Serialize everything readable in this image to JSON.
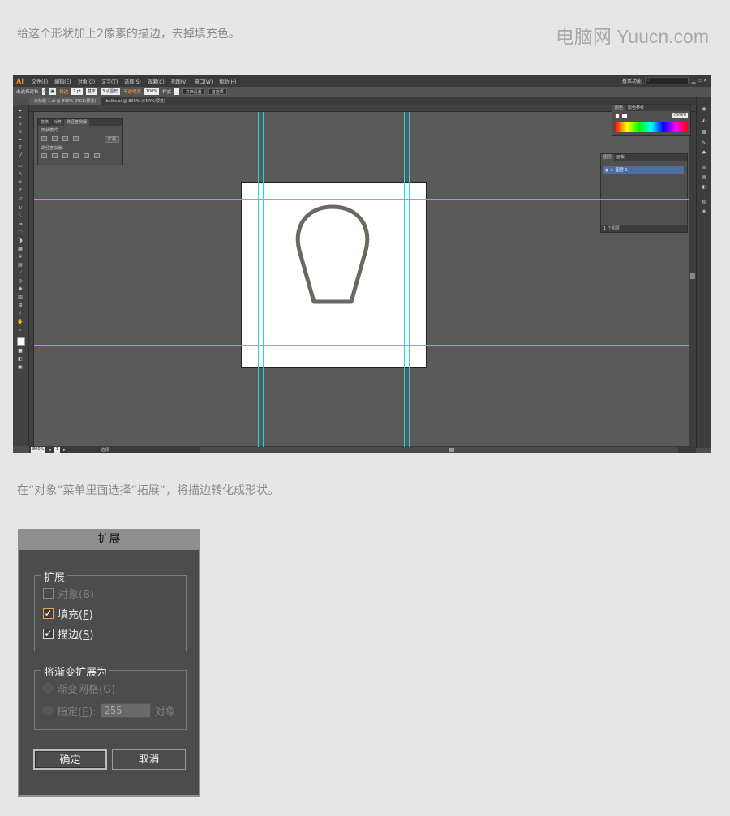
{
  "caption_top": "给这个形状加上2像素的描边，去掉填充色。",
  "watermark": "电脑网 Yuucn.com",
  "caption_mid": "在“对象“菜单里面选择”拓展“，将描边转化成形状。",
  "illustrator": {
    "logo": "Ai",
    "menus": [
      "文件(F)",
      "编辑(E)",
      "对象(O)",
      "文字(T)",
      "选择(S)",
      "效果(C)",
      "视图(V)",
      "窗口(W)",
      "帮助(H)"
    ],
    "workspace": "基本功能",
    "control_bar": {
      "selection": "未选择对象",
      "stroke_label": "描边",
      "stroke_weight": "2 pt",
      "stroke_style": "基本",
      "brush": "3 点圆形",
      "opacity_label": "不透明度",
      "opacity": "100%",
      "style_label": "样式",
      "doc_setup": "文档设置",
      "preferences": "首选项"
    },
    "tabs": [
      "未标题-1.ai @ 800% (RGB/预览)",
      "bulbs.ai @ 800% (CMYK/预览)"
    ],
    "pathfinder_panel": {
      "tabs": [
        "变换",
        "对齐",
        "路径查找器"
      ],
      "shape_modes": "形状模式：",
      "expand": "扩展",
      "pathfinders": "路径查找器："
    },
    "color_panel": {
      "tabs": [
        "颜色",
        "颜色参考"
      ],
      "hex": "f0f0f0"
    },
    "layers_panel": {
      "tabs": [
        "图层",
        "画板"
      ],
      "layer": "图层 1",
      "footer": "1 个图层"
    },
    "status": {
      "zoom": "800%",
      "page": "1",
      "mode": "选择"
    },
    "guides": {
      "stroke_color": "#1fd6e0"
    },
    "shape": {
      "stroke_color": "#6d6762",
      "stroke_width": 5
    }
  },
  "expand_dialog": {
    "title": "扩展",
    "group1_label": "扩展",
    "object": "对象(",
    "object_key": "B",
    "fill": "填充(",
    "fill_key": "F",
    "stroke": "描边(",
    "stroke_key": "S",
    "close_paren": ")",
    "fill_checked": true,
    "stroke_checked": true,
    "object_checked": false,
    "group2_label": "将渐变扩展为",
    "gradient_mesh": "渐变网格(",
    "gradient_mesh_key": "G",
    "specify": "指定(",
    "specify_key": "E",
    "specify_suffix": "):",
    "specify_value": "255",
    "objects_unit": "对象",
    "ok": "确定",
    "cancel": "取消"
  }
}
